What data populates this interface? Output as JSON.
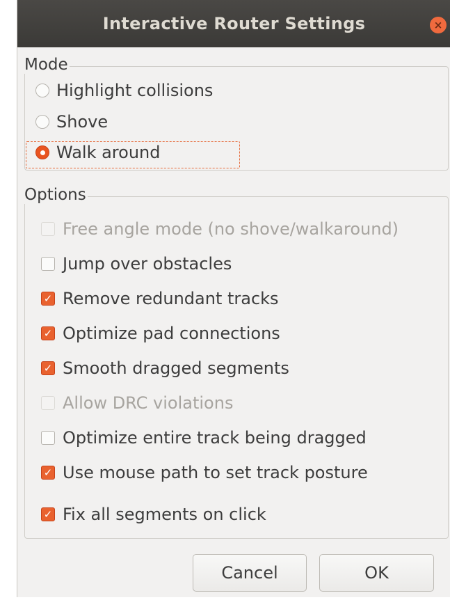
{
  "dialog": {
    "title": "Interactive Router Settings",
    "close_glyph": "×"
  },
  "mode": {
    "label": "Mode",
    "options": [
      {
        "label": "Highlight collisions",
        "selected": false
      },
      {
        "label": "Shove",
        "selected": false
      },
      {
        "label": "Walk around",
        "selected": true
      }
    ]
  },
  "options": {
    "label": "Options",
    "items": [
      {
        "label": "Free angle mode (no shove/walkaround)",
        "checked": false,
        "enabled": false
      },
      {
        "label": "Jump over obstacles",
        "checked": false,
        "enabled": true
      },
      {
        "label": "Remove redundant tracks",
        "checked": true,
        "enabled": true
      },
      {
        "label": "Optimize pad connections",
        "checked": true,
        "enabled": true
      },
      {
        "label": "Smooth dragged segments",
        "checked": true,
        "enabled": true
      },
      {
        "label": "Allow DRC violations",
        "checked": false,
        "enabled": false
      },
      {
        "label": "Optimize entire track being dragged",
        "checked": false,
        "enabled": true
      },
      {
        "label": "Use mouse path to set track posture",
        "checked": true,
        "enabled": true
      },
      {
        "label": "Fix all segments on click",
        "checked": true,
        "enabled": true
      }
    ],
    "check_glyph": "✓"
  },
  "buttons": {
    "cancel": "Cancel",
    "ok": "OK"
  },
  "colors": {
    "accent": "#e95420",
    "titlebar": "#3b3a37",
    "window": "#f2f1f0"
  }
}
